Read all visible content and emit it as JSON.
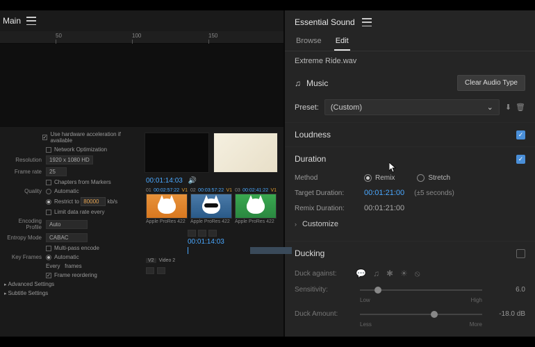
{
  "left": {
    "title": "Main",
    "ruler": [
      "50",
      "100",
      "150"
    ],
    "settings": {
      "hw_accel": "Use hardware acceleration if available",
      "net_opt": "Network Optimization",
      "resolution_label": "Resolution",
      "resolution": "1920 x 1080 HD",
      "framerate_label": "Frame rate",
      "framerate": "25",
      "chapters": "Chapters from Markers",
      "quality_label": "Quality",
      "auto": "Automatic",
      "restrict": "Restrict to",
      "restrict_val": "80000",
      "restrict_unit": "kb/s",
      "limit_rate": "Limit data rate every",
      "encoding_label": "Encoding Profile",
      "encoding": "Auto",
      "entropy_label": "Entropy Mode",
      "entropy": "CABAC",
      "multipass": "Multi-pass encode",
      "keyframes_label": "Key Frames",
      "kf_auto": "Automatic",
      "kf_every": "Every",
      "kf_frames": "frames",
      "reorder": "Frame reordering",
      "advanced": "Advanced Settings",
      "subtitle": "Subtitle Settings"
    },
    "preview": {
      "tc": "00:01:14:03",
      "clips": [
        {
          "n": "01",
          "tc": "00:02:57:22",
          "v": "V1",
          "cap": "Apple ProRes 422"
        },
        {
          "n": "02",
          "tc": "00:03:57:22",
          "v": "V1",
          "cap": "Apple ProRes 422"
        },
        {
          "n": "03",
          "tc": "00:02:41:22",
          "v": "V1",
          "cap": "Apple ProRes 422"
        }
      ],
      "timeline_tc": "00:01:14:03",
      "track_v2": "V2",
      "track_v2_name": "Video 2"
    }
  },
  "right": {
    "title": "Essential Sound",
    "tabs": {
      "browse": "Browse",
      "edit": "Edit"
    },
    "file": "Extreme Ride.wav",
    "type": "Music",
    "clear_btn": "Clear Audio Type",
    "preset_label": "Preset:",
    "preset": "(Custom)",
    "loudness": "Loudness",
    "duration": "Duration",
    "method_label": "Method",
    "remix": "Remix",
    "stretch": "Stretch",
    "target_label": "Target Duration:",
    "target_val": "00:01:21:00",
    "target_hint": "(±5 seconds)",
    "remix_label": "Remix Duration:",
    "remix_val": "00:01:21:00",
    "customize": "Customize",
    "ducking": "Ducking",
    "duck_against": "Duck against:",
    "sensitivity_label": "Sensitivity:",
    "sensitivity_val": "6.0",
    "sens_low": "Low",
    "sens_high": "High",
    "amount_label": "Duck Amount:",
    "amount_val": "-18.0 dB",
    "amt_less": "Less",
    "amt_more": "More"
  }
}
